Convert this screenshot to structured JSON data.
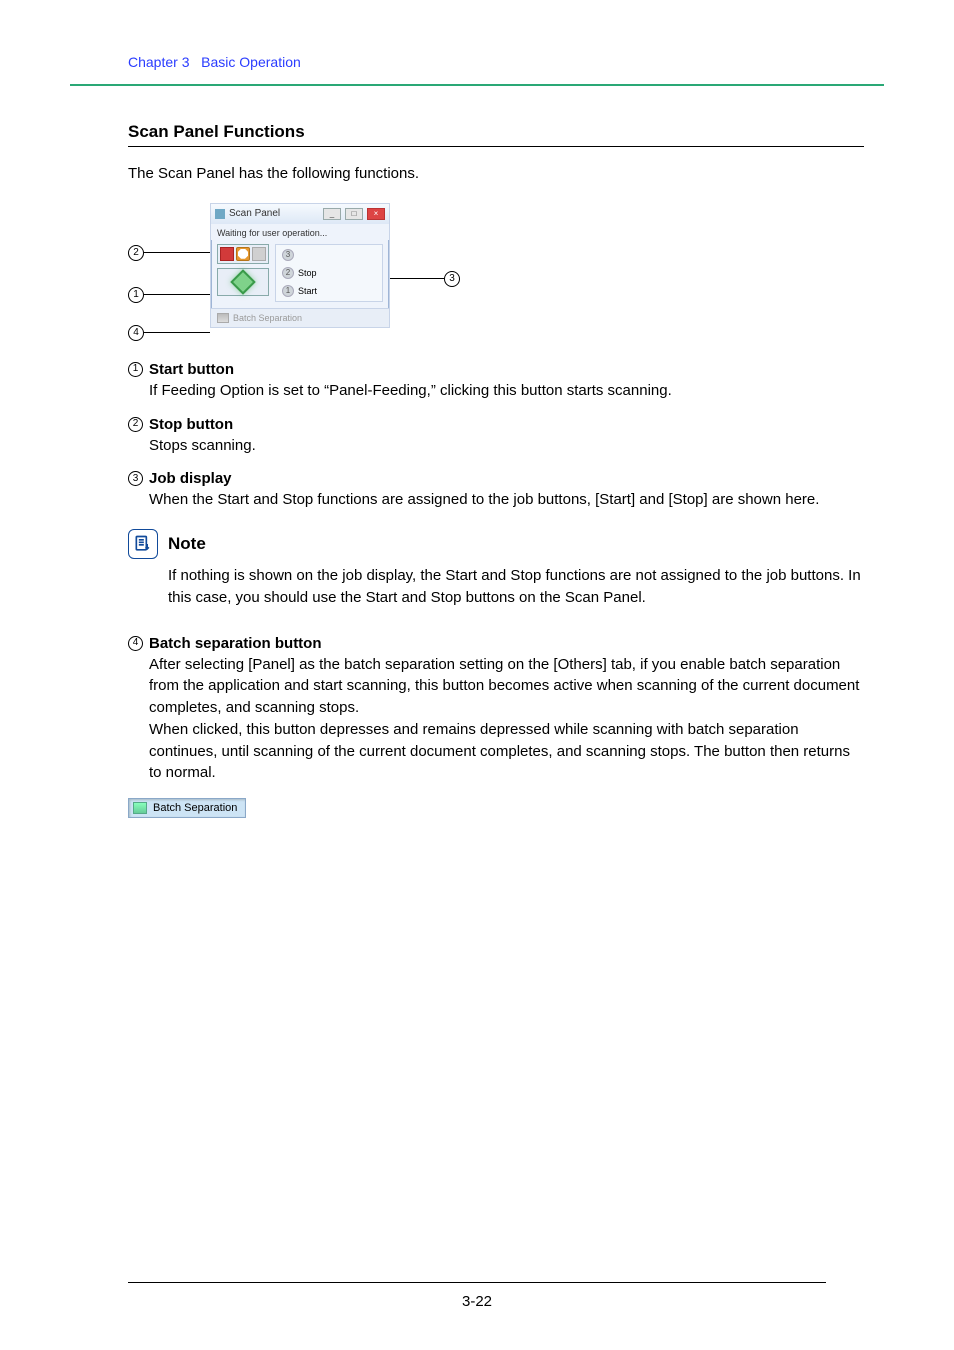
{
  "header": {
    "chapter": "Chapter 3",
    "title": "Basic Operation"
  },
  "section": {
    "heading": "Scan Panel Functions",
    "intro": "The Scan Panel has the following functions."
  },
  "figure": {
    "window_title": "Scan Panel",
    "status_text": "Waiting for user operation...",
    "job3": "",
    "job2": "Stop",
    "job1": "Start",
    "footer_label": "Batch Separation",
    "callouts": {
      "c1": "1",
      "c2": "2",
      "c3": "3",
      "c4": "4"
    }
  },
  "items": [
    {
      "num": "1",
      "title": "Start button",
      "body": "If Feeding Option is set to “Panel-Feeding,” clicking this button starts scanning."
    },
    {
      "num": "2",
      "title": "Stop button",
      "body": "Stops scanning."
    },
    {
      "num": "3",
      "title": "Job display",
      "body": "When the Start and Stop functions are assigned to the job buttons, [Start] and [Stop] are shown here."
    }
  ],
  "note": {
    "label": "Note",
    "body": "If nothing is shown on the job display, the Start and Stop functions are not assigned to the job buttons. In this case, you should use the Start and Stop buttons on the Scan Panel."
  },
  "item4": {
    "num": "4",
    "title": "Batch separation button",
    "body": "After selecting [Panel] as the batch separation setting on the [Others] tab, if you enable batch separation from the application and start scanning, this button becomes active when scanning of the current document completes, and scanning stops.\nWhen clicked, this button depresses and remains depressed while scanning with batch separation continues, until scanning of the current document completes, and scanning stops. The button then returns to normal."
  },
  "depressed_button": {
    "label": "Batch Separation"
  },
  "page_number": "3-22"
}
